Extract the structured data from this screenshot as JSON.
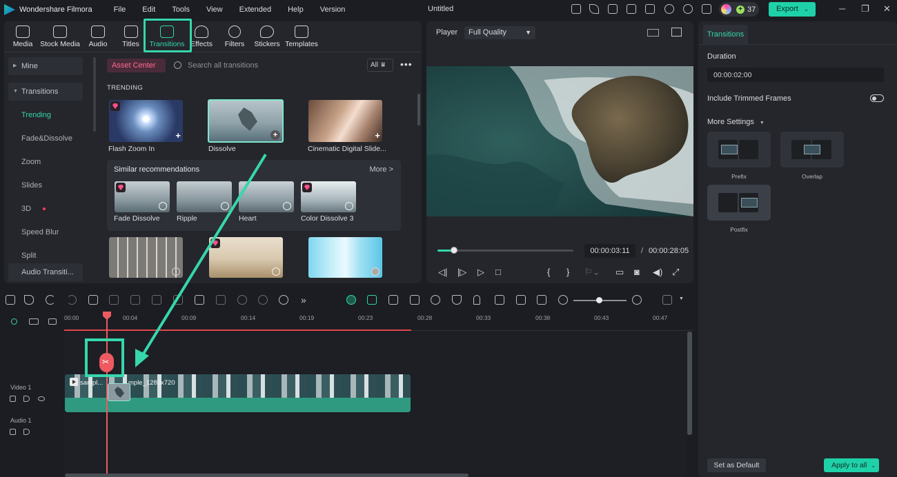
{
  "app": {
    "name": "Wondershare Filmora",
    "doc_title": "Untitled",
    "credits": "37",
    "export_label": "Export",
    "accent": "#34d6ad",
    "highlight": "#37d7ad"
  },
  "menu": [
    "File",
    "Edit",
    "Tools",
    "View",
    "Extended",
    "Help",
    "Version"
  ],
  "tabs": [
    {
      "label": "Media",
      "icon": "media-icon"
    },
    {
      "label": "Stock Media",
      "icon": "stock-media-icon"
    },
    {
      "label": "Audio",
      "icon": "audio-icon"
    },
    {
      "label": "Titles",
      "icon": "titles-icon"
    },
    {
      "label": "Transitions",
      "icon": "transitions-icon",
      "active": true
    },
    {
      "label": "Effects",
      "icon": "effects-icon"
    },
    {
      "label": "Filters",
      "icon": "filters-icon"
    },
    {
      "label": "Stickers",
      "icon": "stickers-icon"
    },
    {
      "label": "Templates",
      "icon": "templates-icon"
    }
  ],
  "sidebar": {
    "mine": "Mine",
    "transitions": "Transitions",
    "items": [
      "Trending",
      "Fade&Dissolve",
      "Zoom",
      "Slides",
      "3D",
      "Speed Blur",
      "Split",
      "Audio Transiti..."
    ],
    "active": "Trending"
  },
  "library": {
    "asset_center": "Asset Center",
    "search_placeholder": "Search all transitions",
    "filter_label": "All",
    "section": "TRENDING",
    "items": [
      "Flash Zoom In",
      "Dissolve",
      "Cinematic Digital Slide..."
    ],
    "similar_title": "Similar recommendations",
    "more_label": "More >",
    "similar_items": [
      "Fade Dissolve",
      "Ripple",
      "Heart",
      "Color Dissolve 3"
    ]
  },
  "player": {
    "label": "Player",
    "quality": "Full Quality",
    "current_time": "00:00:03:11",
    "separator": "/",
    "total_time": "00:00:28:05",
    "progress": 0.12
  },
  "properties": {
    "tab": "Transitions",
    "duration_label": "Duration",
    "duration_value": "00:00:02:00",
    "include_trimmed": "Include Trimmed Frames",
    "more_settings": "More Settings",
    "modes": [
      "Prefix",
      "Overlap",
      "Postfix"
    ],
    "selected_mode": "Postfix",
    "set_default": "Set as Default",
    "apply_all": "Apply to all"
  },
  "timeline": {
    "ticks": [
      "00:00",
      "00:04",
      "00:09",
      "00:14",
      "00:19",
      "00:23",
      "00:28",
      "00:33",
      "00:38",
      "00:43",
      "00:47"
    ],
    "video_track": "Video 1",
    "audio_track": "Audio 1",
    "clip_name_1": "sampl...",
    "clip_name_2": "mple_1280x720"
  }
}
